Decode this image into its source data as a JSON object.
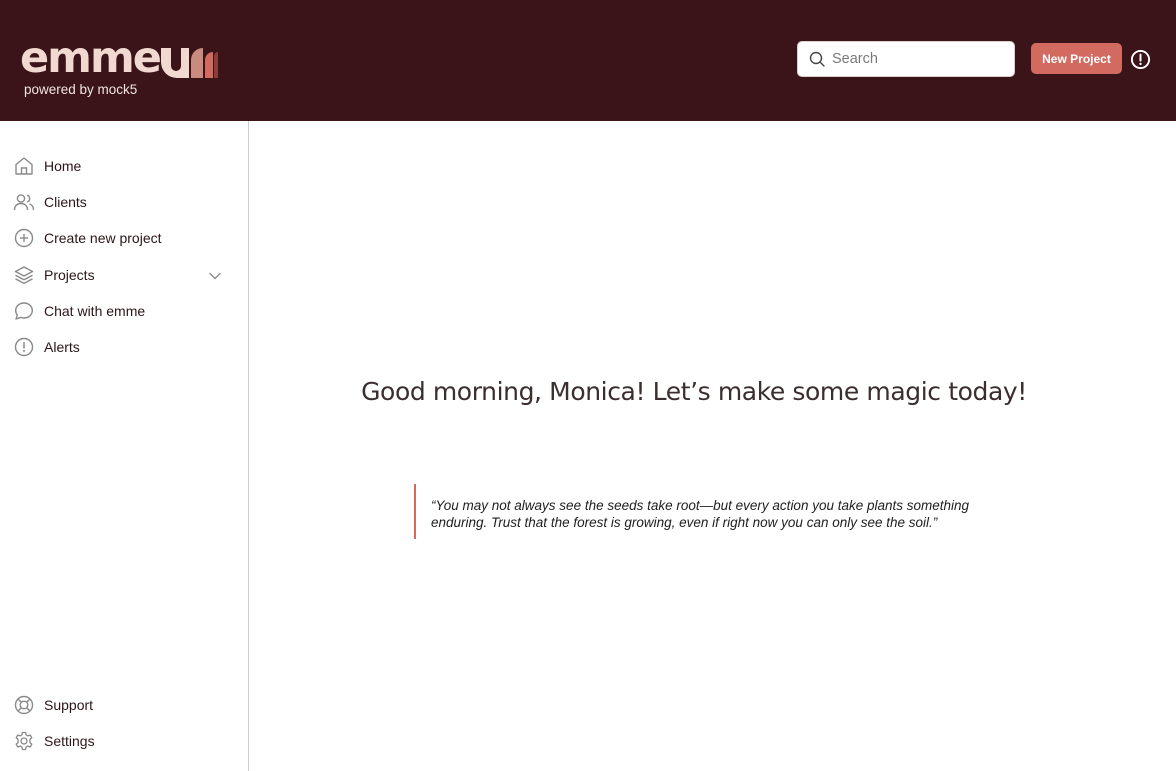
{
  "header": {
    "logo_text": "emme",
    "tagline": "powered by mock5",
    "search": {
      "placeholder": "Search",
      "value": ""
    },
    "new_project_label": "New Project"
  },
  "sidebar": {
    "items": [
      {
        "label": "Home",
        "icon": "home-icon"
      },
      {
        "label": "Clients",
        "icon": "users-icon"
      },
      {
        "label": "Create new project",
        "icon": "plus-circle-icon"
      },
      {
        "label": "Projects",
        "icon": "layers-icon",
        "expandable": true
      },
      {
        "label": "Chat with emme",
        "icon": "chat-bubble-icon"
      },
      {
        "label": "Alerts",
        "icon": "alert-circle-icon"
      }
    ],
    "footer_items": [
      {
        "label": "Support",
        "icon": "lifebuoy-icon"
      },
      {
        "label": "Settings",
        "icon": "gear-icon"
      }
    ]
  },
  "main": {
    "greeting": "Good morning, Monica! Let’s make some magic today!",
    "quote": "“You may not always see the seeds take root—but every action you take plants something enduring. Trust that the forest is growing, even if right now you can only see the soil.”"
  },
  "colors": {
    "header_bg": "#3a1418",
    "accent": "#d26a60",
    "logo_text": "#f1d9d1"
  }
}
